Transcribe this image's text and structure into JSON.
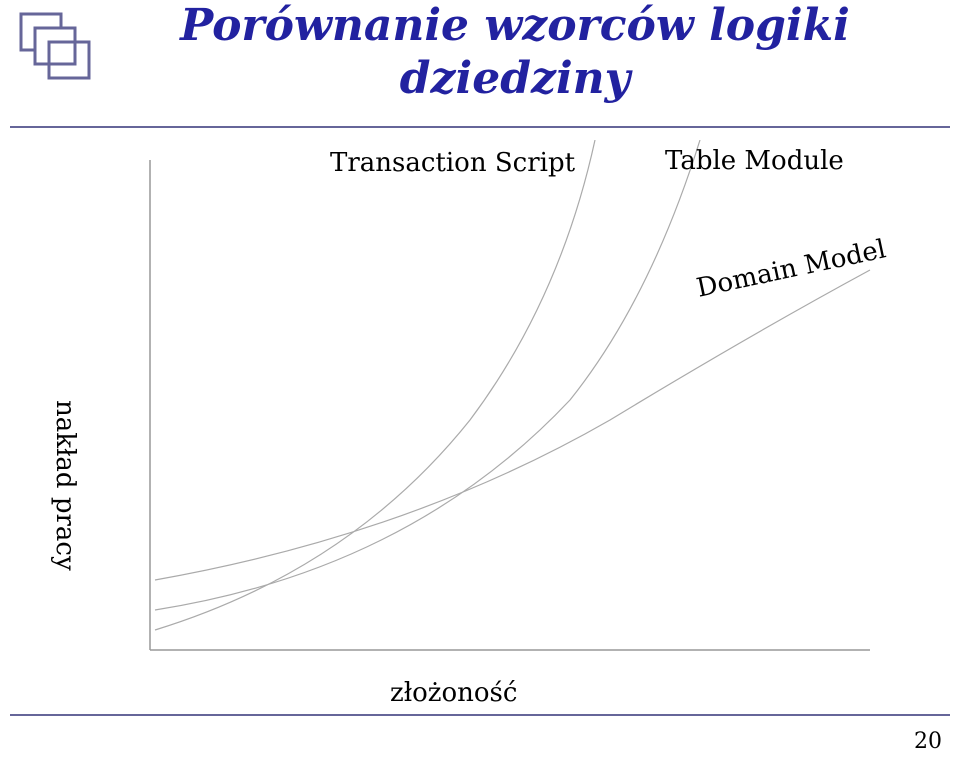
{
  "title": {
    "line1": "Porównanie wzorców logiki",
    "line2": "dziedziny"
  },
  "page_number": "20",
  "chart_data": {
    "type": "line",
    "title": "Porównanie wzorców logiki dziedziny",
    "xlabel": "złożoność",
    "ylabel": "nakład pracy",
    "xlim": [
      0,
      10
    ],
    "ylim": [
      0,
      10
    ],
    "series": [
      {
        "name": "Transaction Script",
        "x": [
          0,
          2,
          4,
          5,
          6,
          6.3
        ],
        "values": [
          0.4,
          1.0,
          3.0,
          5.5,
          9.0,
          10.0
        ]
      },
      {
        "name": "Table Module",
        "x": [
          0,
          2,
          4,
          6,
          7,
          7.6
        ],
        "values": [
          0.8,
          1.3,
          2.5,
          5.5,
          8.5,
          10.0
        ]
      },
      {
        "name": "Domain Model",
        "x": [
          0,
          2,
          4,
          6,
          8,
          10
        ],
        "values": [
          1.4,
          1.9,
          2.8,
          4.4,
          6.2,
          7.5
        ]
      }
    ],
    "legend_position": "top",
    "grid": false
  }
}
